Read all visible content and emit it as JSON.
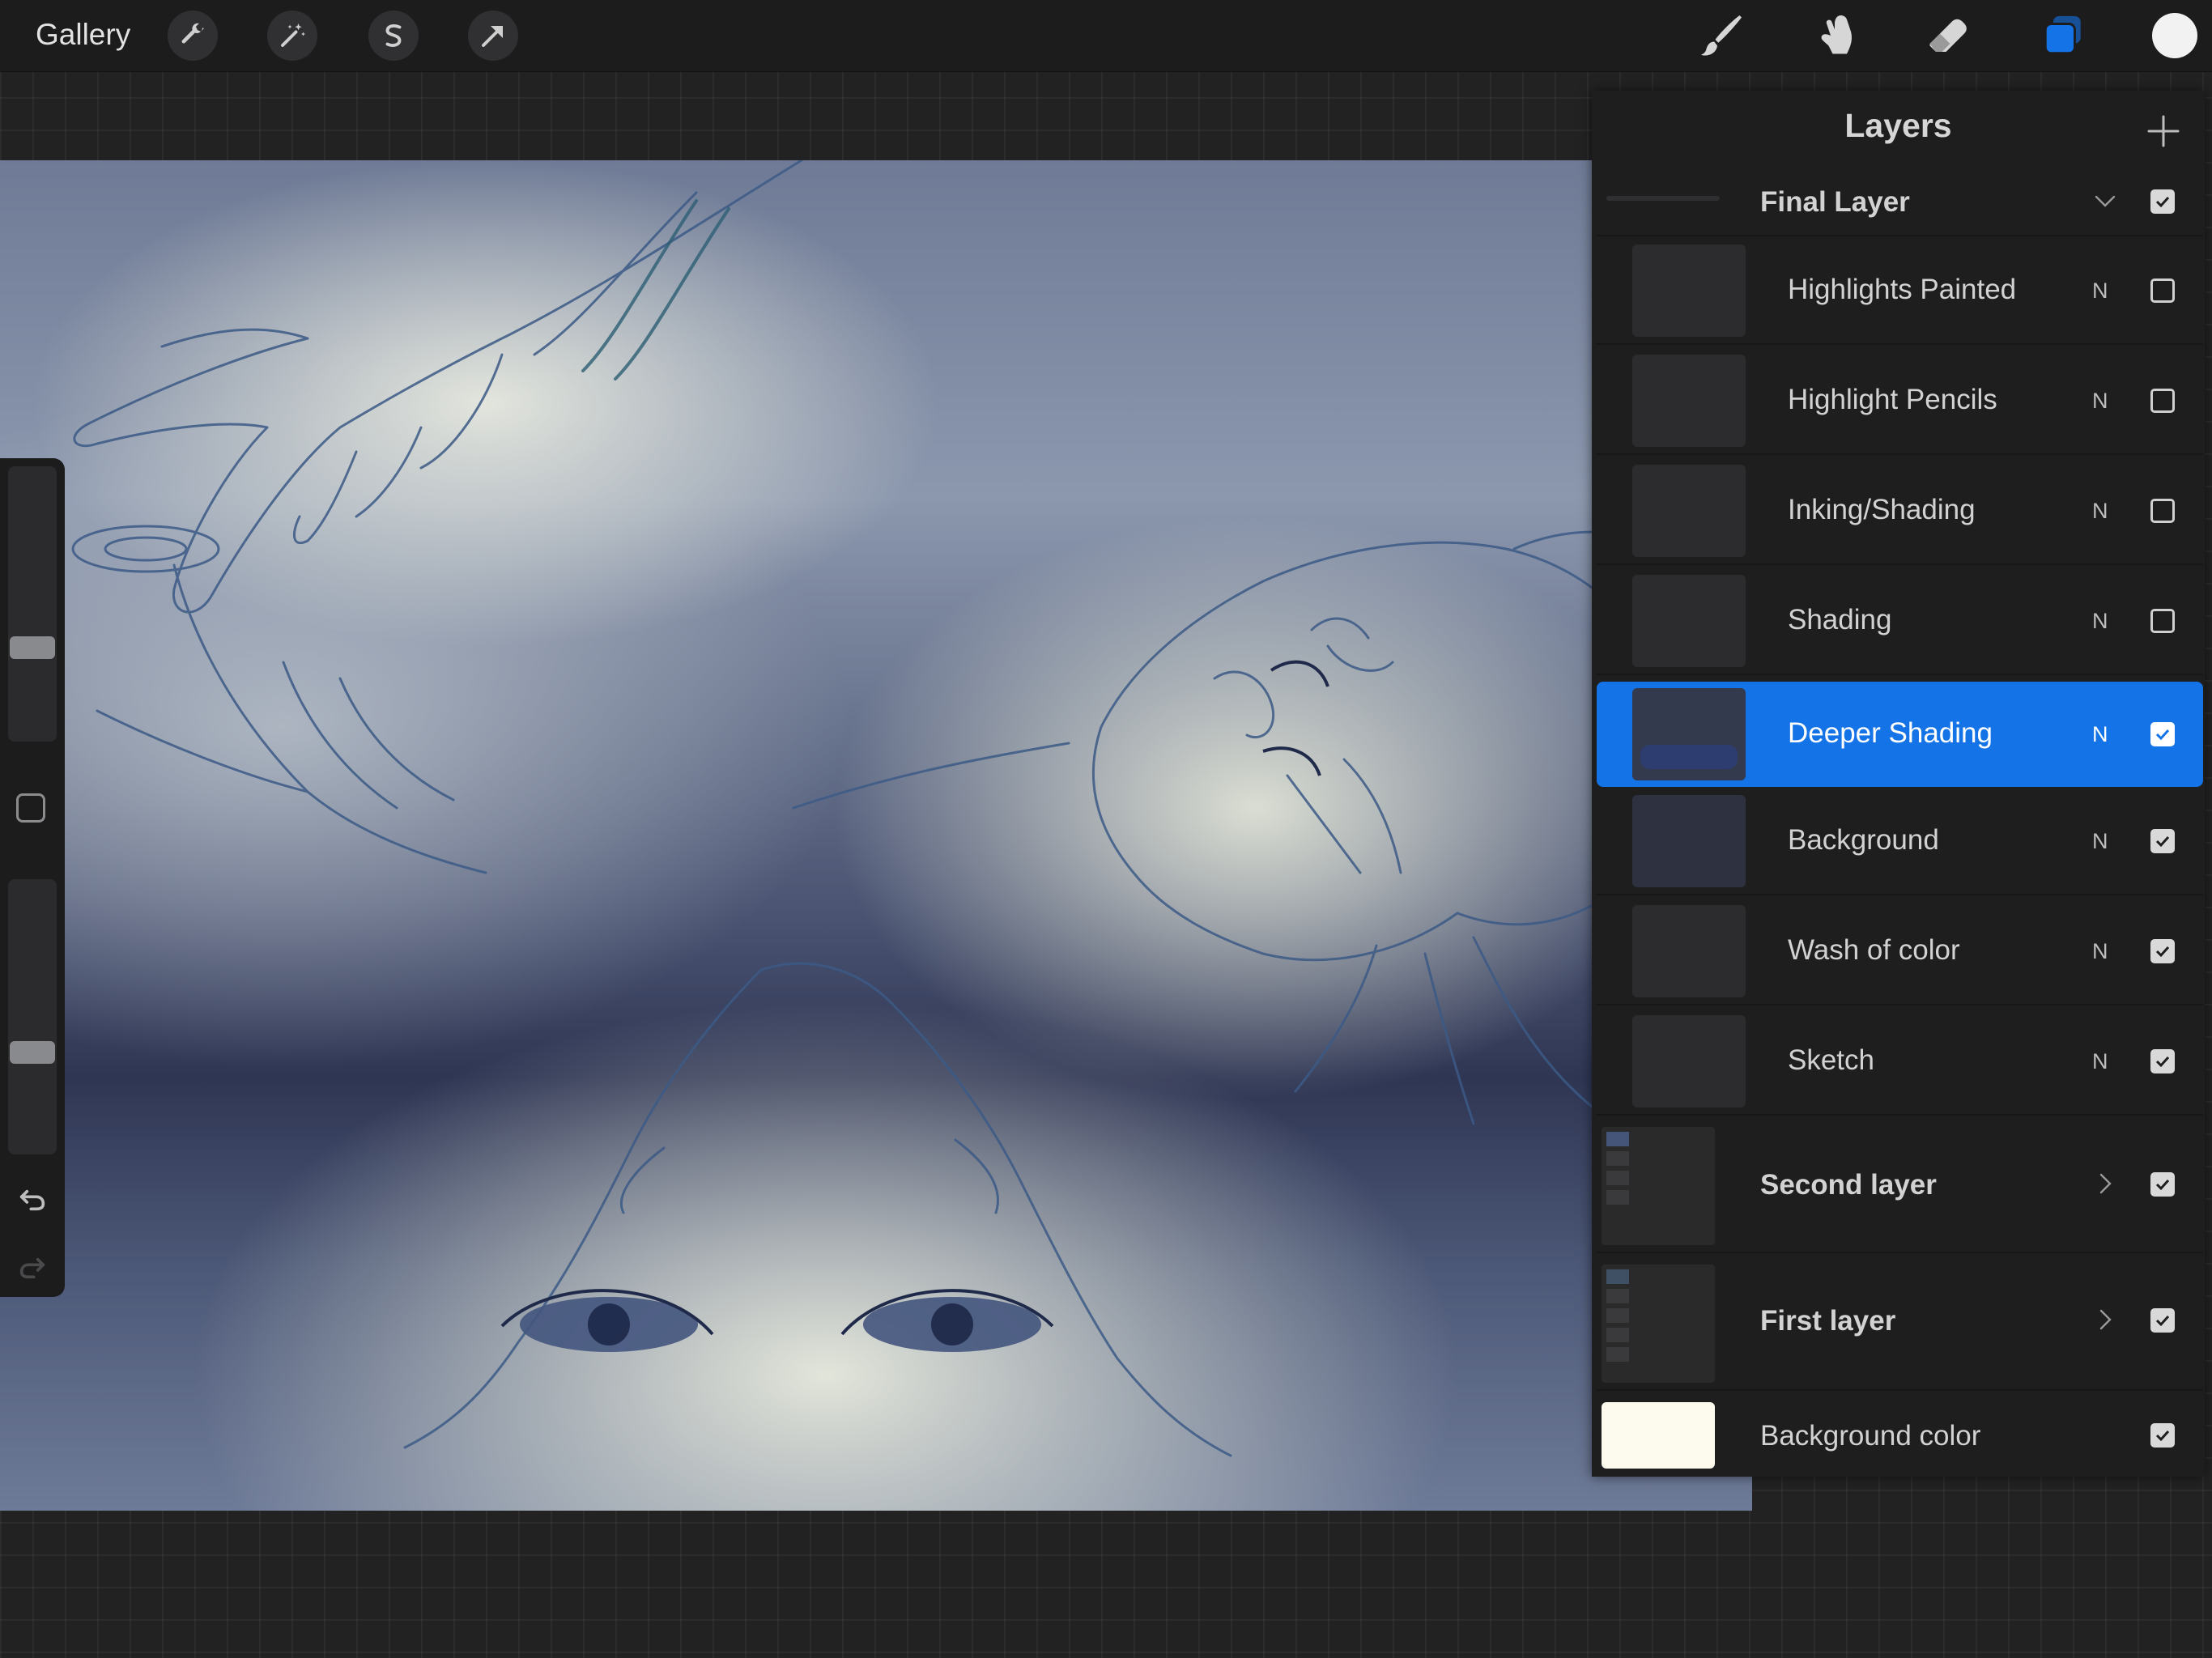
{
  "topbar": {
    "gallery_label": "Gallery",
    "left_tools": [
      "wrench-icon",
      "magic-wand-icon",
      "selection-s-icon",
      "transform-arrow-icon"
    ],
    "right_tools": [
      "brush-icon",
      "smudge-icon",
      "eraser-icon",
      "layers-icon"
    ],
    "active_tool": "layers-icon",
    "current_color": "#f2f2f2",
    "accent_color": "#1473e6"
  },
  "sidebar": {
    "brush_size_level": 0.35,
    "opacity_level": 0.62,
    "tools": [
      "modify-square-icon",
      "undo-icon",
      "redo-icon"
    ]
  },
  "layers": {
    "title": "Layers",
    "add_icon": "plus-icon",
    "group_open": {
      "name": "Final Layer",
      "visible": true
    },
    "items": [
      {
        "name": "Highlights Painted",
        "blend": "N",
        "visible": false,
        "selected": false
      },
      {
        "name": "Highlight Pencils",
        "blend": "N",
        "visible": false,
        "selected": false
      },
      {
        "name": "Inking/Shading",
        "blend": "N",
        "visible": false,
        "selected": false
      },
      {
        "name": "Shading",
        "blend": "N",
        "visible": false,
        "selected": false
      },
      {
        "name": "Deeper Shading",
        "blend": "N",
        "visible": true,
        "selected": true
      },
      {
        "name": "Background",
        "blend": "N",
        "visible": true,
        "selected": false
      },
      {
        "name": "Wash of color",
        "blend": "N",
        "visible": true,
        "selected": false
      },
      {
        "name": "Sketch",
        "blend": "N",
        "visible": true,
        "selected": false
      }
    ],
    "groups_collapsed": [
      {
        "name": "Second layer",
        "visible": true
      },
      {
        "name": "First layer",
        "visible": true
      }
    ],
    "background_color": {
      "name": "Background color",
      "visible": true,
      "color": "#fdfbee"
    }
  }
}
